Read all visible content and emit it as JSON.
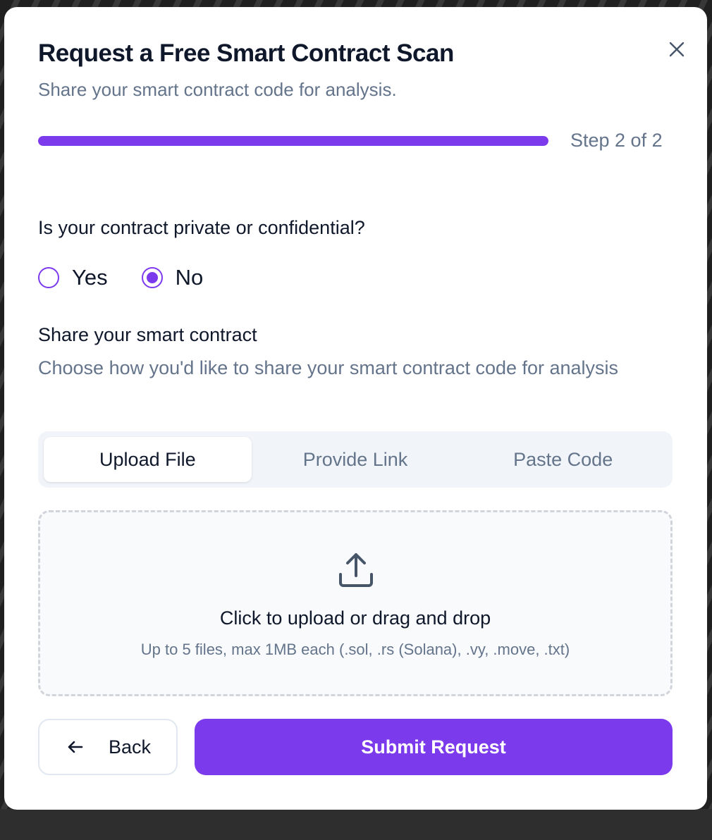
{
  "modal": {
    "title": "Request a Free Smart Contract Scan",
    "subtitle": "Share your smart contract code for analysis.",
    "close_icon": "close-icon"
  },
  "progress": {
    "fraction": 1.0,
    "label": "Step 2 of 2",
    "fill_color": "#7c3aed",
    "track_color": "#e9d5ff"
  },
  "privacy": {
    "question": "Is your contract private or confidential?",
    "options": [
      {
        "label": "Yes",
        "selected": false
      },
      {
        "label": "No",
        "selected": true
      }
    ]
  },
  "share": {
    "title": "Share your smart contract",
    "description": "Choose how you'd like to share your smart contract code for analysis"
  },
  "tabs": [
    {
      "label": "Upload File",
      "active": true
    },
    {
      "label": "Provide Link",
      "active": false
    },
    {
      "label": "Paste Code",
      "active": false
    }
  ],
  "dropzone": {
    "icon": "upload-icon",
    "title": "Click to upload or drag and drop",
    "hint": "Up to 5 files, max 1MB each (.sol, .rs (Solana), .vy, .move, .txt)"
  },
  "actions": {
    "back_label": "Back",
    "back_icon": "arrow-left-icon",
    "submit_label": "Submit Request"
  },
  "colors": {
    "accent": "#7c3aed",
    "heading": "#0f172a",
    "muted": "#64748b"
  }
}
